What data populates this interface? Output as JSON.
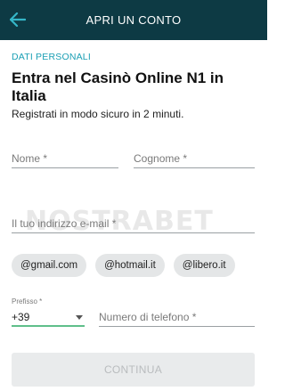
{
  "appbar": {
    "title": "APRI UN CONTO",
    "back_icon": "arrow-left-icon",
    "background": "#0d3a44",
    "icon_color": "#35b6c8"
  },
  "section": {
    "label": "DATI PERSONALI",
    "color": "#1a9fb4"
  },
  "heading": "Entra nel Casinò Online N1 in Italia",
  "subheading": "Registrati in modo sicuro in 2 minuti.",
  "form": {
    "first_name_placeholder": "Nome *",
    "last_name_placeholder": "Cognome *",
    "email_placeholder": "Il tuo indirizzo e-mail *",
    "email_suggestions": [
      "@gmail.com",
      "@hotmail.it",
      "@libero.it"
    ],
    "prefix_label": "Prefisso *",
    "prefix_value": "+39",
    "phone_placeholder": "Numero di telefono *",
    "continue_label": "CONTINUA"
  },
  "watermark": {
    "text": "NOSTRABET"
  }
}
